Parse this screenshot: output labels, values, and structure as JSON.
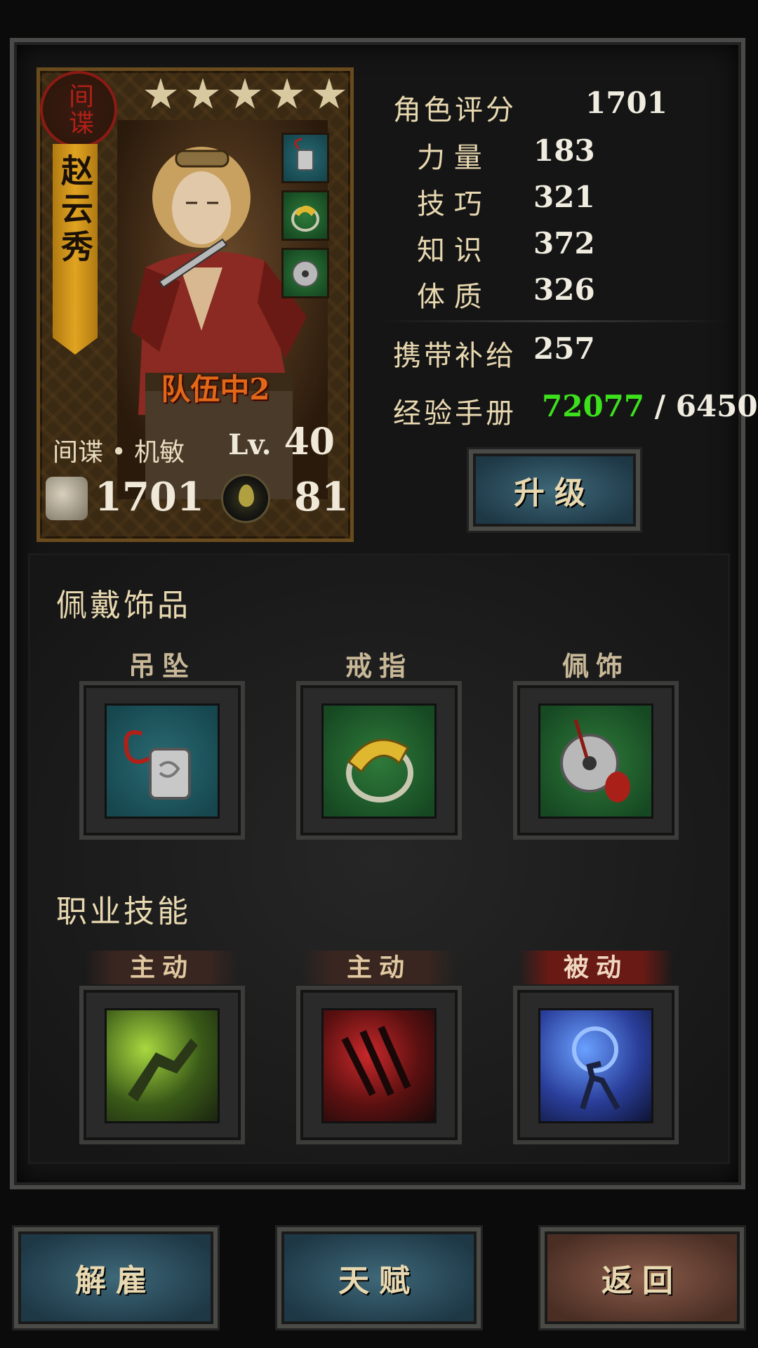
{
  "character": {
    "class_seal": "间谍",
    "name": "赵云秀",
    "stars": 5,
    "squad_tag": "队伍中2",
    "class_line": "间谍 • 机敏",
    "level_prefix": "Lv.",
    "level": "40",
    "power": "1701",
    "stamina": "81",
    "mini_equips": [
      "pendant-icon",
      "ring-icon",
      "ornament-icon"
    ]
  },
  "stats": {
    "rating_label": "角色评分",
    "rating_value": "1701",
    "strength_label": "力 量",
    "strength_value": "183",
    "skill_label": "技 巧",
    "skill_value": "321",
    "knowledge_label": "知 识",
    "knowledge_value": "372",
    "constitution_label": "体 质",
    "constitution_value": "326",
    "supply_label": "携带补给",
    "supply_value": "257",
    "exp_label": "经验手册",
    "exp_current": "72077",
    "exp_separator": " / ",
    "exp_required": "6450",
    "exp_current_color": "#3ce01c"
  },
  "upgrade_button": "升级",
  "accessories": {
    "title": "佩戴饰品",
    "slots": [
      {
        "label": "吊坠",
        "icon": "pendant-icon"
      },
      {
        "label": "戒指",
        "icon": "ring-icon"
      },
      {
        "label": "佩饰",
        "icon": "ornament-icon"
      }
    ]
  },
  "skills": {
    "title": "职业技能",
    "slots": [
      {
        "label": "主动",
        "icon": "green-strike-skill-icon"
      },
      {
        "label": "主动",
        "icon": "red-claw-skill-icon"
      },
      {
        "label": "被动",
        "icon": "blue-spirit-skill-icon"
      }
    ]
  },
  "bottom_buttons": {
    "dismiss": "解雇",
    "talent": "天赋",
    "back": "返回"
  },
  "colors": {
    "button_blue": "#2e5262",
    "button_brown": "#6a4438",
    "banner_gold": "#e0a321",
    "seal_red": "#b02018"
  }
}
